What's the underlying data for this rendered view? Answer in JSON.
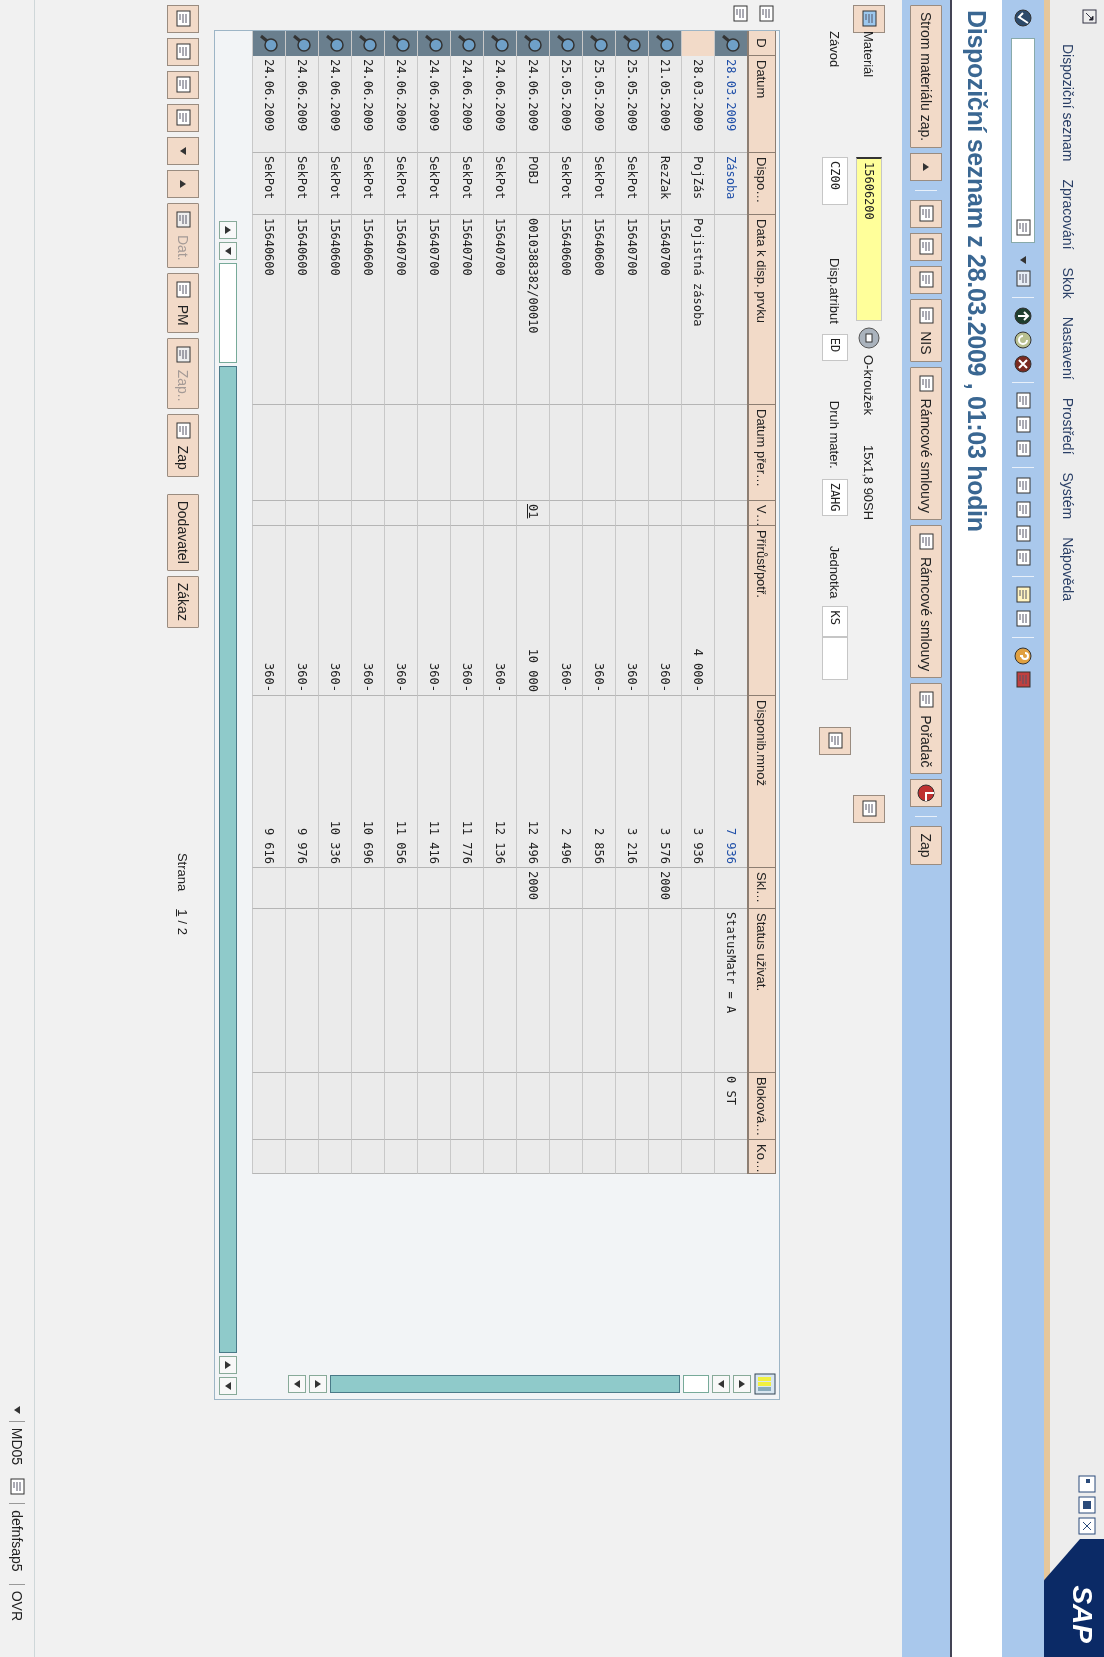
{
  "window": {
    "logo": "SAP"
  },
  "menu": [
    "Dispoziční seznam",
    "Zpracování",
    "Skok",
    "Nastavení",
    "Prostředí",
    "Systém",
    "Nápověda"
  ],
  "title": "Dispoziční seznam z 28.03.2009 , 01:03 hodin",
  "app_toolbar": [
    {
      "label": "Strom materiálu zap."
    },
    {
      "label": "NIS"
    },
    {
      "label": "Rámcové smlouvy"
    },
    {
      "label": "Rámcové smlouvy"
    },
    {
      "label": "Pořadač"
    },
    {
      "label": "Zap"
    }
  ],
  "header": {
    "material": {
      "label": "Materiál",
      "value": "15606200",
      "focused": true
    },
    "description": "O-kroužek",
    "size": "15x1,8 90SH",
    "fields": [
      {
        "label": "Závod",
        "value": "CZ00"
      },
      {
        "label": "Disp.atribut",
        "value": "ED"
      },
      {
        "label": "Druh mater.",
        "value": "ZAHG"
      },
      {
        "label": "Jednotka",
        "value": "KS"
      }
    ]
  },
  "table": {
    "columns": [
      {
        "label": "D",
        "kind": "icon"
      },
      {
        "label": "Datum",
        "kind": "text"
      },
      {
        "label": "Dispo…",
        "kind": "text"
      },
      {
        "label": "Data k disp. prvku",
        "kind": "text"
      },
      {
        "label": "Datum přer…",
        "kind": "text"
      },
      {
        "label": "V…",
        "kind": "link"
      },
      {
        "label": "Přírůst/potř.",
        "kind": "number"
      },
      {
        "label": "Disponib.množ",
        "kind": "number"
      },
      {
        "label": "Skl…",
        "kind": "text"
      },
      {
        "label": "Status uživat.",
        "kind": "text"
      },
      {
        "label": "Bloková…",
        "kind": "text"
      },
      {
        "label": "Ko…",
        "kind": "text"
      }
    ],
    "rows": [
      {
        "has_detail": true,
        "highlighted": true,
        "date": "28.03.2009",
        "element": "Zásoba",
        "available": "7 936",
        "status": "StatusMatr = A",
        "blocked": "0 ST"
      },
      {
        "has_detail": false,
        "highlighted": false,
        "date": "28.03.2009",
        "element": "PojZás",
        "data": "Pojistná zásoba",
        "receipt": "4 000-",
        "available": "3 936"
      },
      {
        "has_detail": true,
        "highlighted": false,
        "date": "21.05.2009",
        "element": "RezZak",
        "data": "15640700",
        "receipt": "360-",
        "available": "3 576",
        "storage": "2000"
      },
      {
        "has_detail": true,
        "highlighted": false,
        "date": "25.05.2009",
        "element": "SekPot",
        "data": "15640700",
        "receipt": "360-",
        "available": "3 216"
      },
      {
        "has_detail": true,
        "highlighted": false,
        "date": "25.05.2009",
        "element": "SekPot",
        "data": "15640600",
        "receipt": "360-",
        "available": "2 856"
      },
      {
        "has_detail": true,
        "highlighted": false,
        "date": "25.05.2009",
        "element": "SekPot",
        "data": "15640600",
        "receipt": "360-",
        "available": "2 496"
      },
      {
        "has_detail": true,
        "highlighted": false,
        "date": "24.06.2009",
        "element": "POBJ",
        "data": "0010388382/00010",
        "v": "01",
        "receipt": "10 000",
        "available": "12 496",
        "storage": "2000"
      },
      {
        "has_detail": true,
        "highlighted": false,
        "date": "24.06.2009",
        "element": "SekPot",
        "data": "15640700",
        "receipt": "360-",
        "available": "12 136"
      },
      {
        "has_detail": true,
        "highlighted": false,
        "date": "24.06.2009",
        "element": "SekPot",
        "data": "15640700",
        "receipt": "360-",
        "available": "11 776"
      },
      {
        "has_detail": true,
        "highlighted": false,
        "date": "24.06.2009",
        "element": "SekPot",
        "data": "15640700",
        "receipt": "360-",
        "available": "11 416"
      },
      {
        "has_detail": true,
        "highlighted": false,
        "date": "24.06.2009",
        "element": "SekPot",
        "data": "15640700",
        "receipt": "360-",
        "available": "11 056"
      },
      {
        "has_detail": true,
        "highlighted": false,
        "date": "24.06.2009",
        "element": "SekPot",
        "data": "15640600",
        "receipt": "360-",
        "available": "10 696"
      },
      {
        "has_detail": true,
        "highlighted": false,
        "date": "24.06.2009",
        "element": "SekPot",
        "data": "15640600",
        "receipt": "360-",
        "available": "10 336"
      },
      {
        "has_detail": true,
        "highlighted": false,
        "date": "24.06.2009",
        "element": "SekPot",
        "data": "15640600",
        "receipt": "360-",
        "available": "9 976"
      },
      {
        "has_detail": true,
        "highlighted": false,
        "date": "24.06.2009",
        "element": "SekPot",
        "data": "15640600",
        "receipt": "360-",
        "available": "9 616"
      }
    ]
  },
  "footer_buttons": [
    {
      "label": "Dat.",
      "disabled": true
    },
    {
      "label": "PM",
      "disabled": false
    },
    {
      "label": "Zap..",
      "disabled": true
    },
    {
      "label": "Zap",
      "disabled": false
    },
    {
      "label": "Dodavatel",
      "disabled": false
    },
    {
      "label": "Zákaz",
      "disabled": false
    }
  ],
  "pager": {
    "label": "Strana",
    "current": "1",
    "total": "/ 2"
  },
  "status_bar": {
    "transaction": "MD05",
    "server": "defnfsap5",
    "mode": "OVR"
  }
}
